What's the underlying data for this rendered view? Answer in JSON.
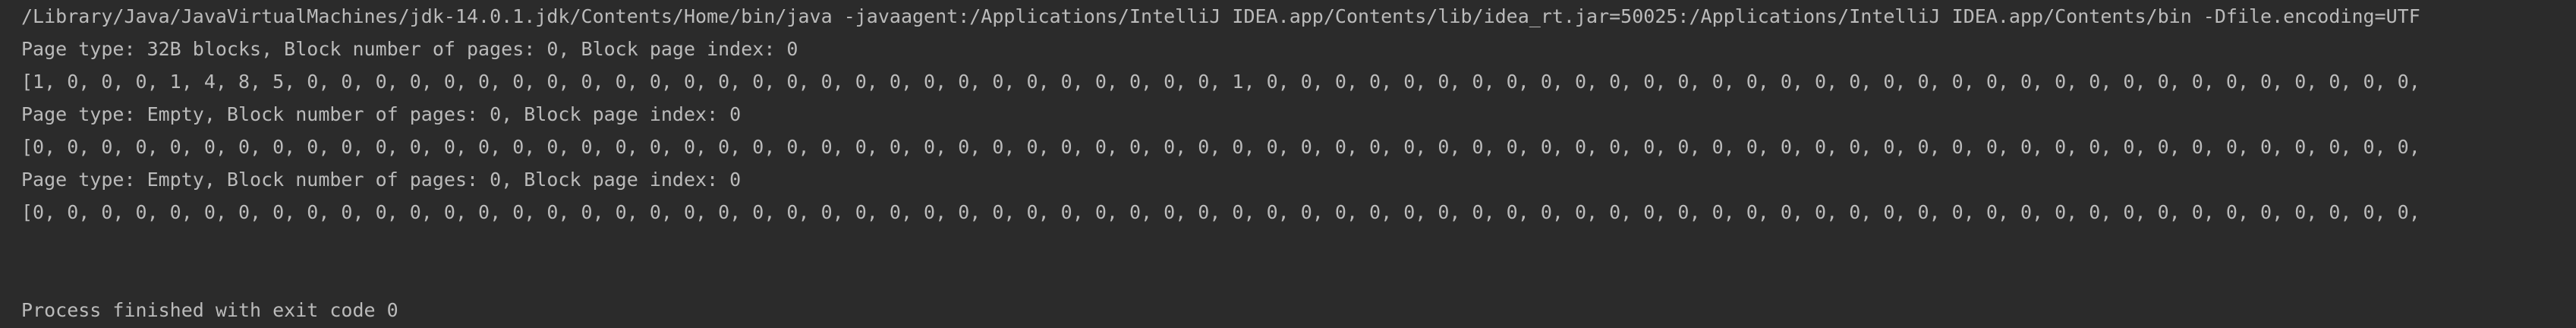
{
  "console": {
    "command_line": "/Library/Java/JavaVirtualMachines/jdk-14.0.1.jdk/Contents/Home/bin/java -javaagent:/Applications/IntelliJ IDEA.app/Contents/lib/idea_rt.jar=50025:/Applications/IntelliJ IDEA.app/Contents/bin -Dfile.encoding=UTF",
    "lines": [
      "Page type: 32B blocks, Block number of pages: 0, Block page index: 0",
      "[1, 0, 0, 0, 1, 4, 8, 5, 0, 0, 0, 0, 0, 0, 0, 0, 0, 0, 0, 0, 0, 0, 0, 0, 0, 0, 0, 0, 0, 0, 0, 0, 0, 0, 0, 1, 0, 0, 0, 0, 0, 0, 0, 0, 0, 0, 0, 0, 0, 0, 0, 0, 0, 0, 0, 0, 0, 0, 0, 0, 0, 0, 0, 0, 0, 0, 0, 0, 0, 0,",
      "Page type: Empty, Block number of pages: 0, Block page index: 0",
      "[0, 0, 0, 0, 0, 0, 0, 0, 0, 0, 0, 0, 0, 0, 0, 0, 0, 0, 0, 0, 0, 0, 0, 0, 0, 0, 0, 0, 0, 0, 0, 0, 0, 0, 0, 0, 0, 0, 0, 0, 0, 0, 0, 0, 0, 0, 0, 0, 0, 0, 0, 0, 0, 0, 0, 0, 0, 0, 0, 0, 0, 0, 0, 0, 0, 0, 0, 0, 0, 0,",
      "Page type: Empty, Block number of pages: 0, Block page index: 0",
      "[0, 0, 0, 0, 0, 0, 0, 0, 0, 0, 0, 0, 0, 0, 0, 0, 0, 0, 0, 0, 0, 0, 0, 0, 0, 0, 0, 0, 0, 0, 0, 0, 0, 0, 0, 0, 0, 0, 0, 0, 0, 0, 0, 0, 0, 0, 0, 0, 0, 0, 0, 0, 0, 0, 0, 0, 0, 0, 0, 0, 0, 0, 0, 0, 0, 0, 0, 0, 0, 0,"
    ],
    "exit_message": "Process finished with exit code 0"
  },
  "colors": {
    "background": "#2b2b2b",
    "text": "#bbbbbb"
  }
}
